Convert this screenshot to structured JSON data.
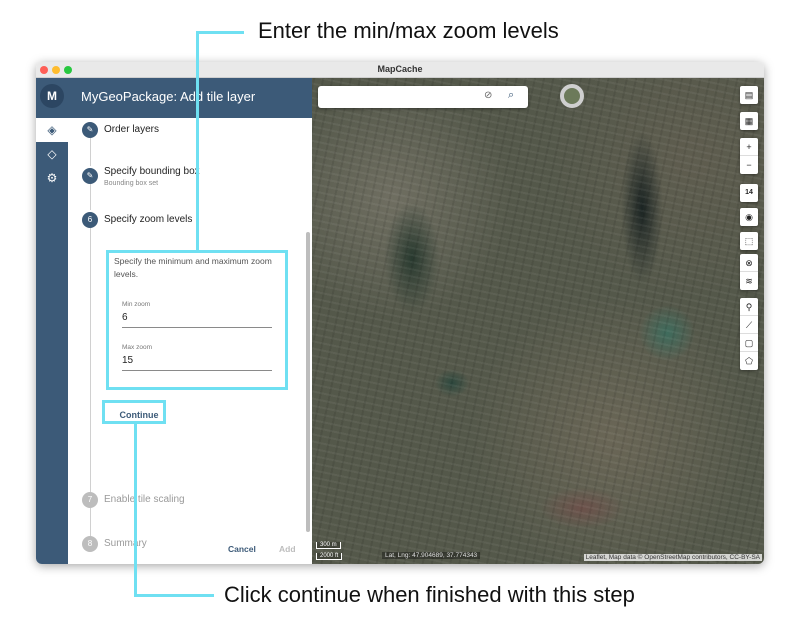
{
  "annotations": {
    "top": "Enter the min/max zoom levels",
    "bottom": "Click continue when finished with this step"
  },
  "window": {
    "title": "MapCache"
  },
  "panel": {
    "title": "MyGeoPackage: Add tile layer",
    "steps": [
      {
        "label": "Order layers",
        "state": "done"
      },
      {
        "label": "Specify bounding box",
        "sub": "Bounding box set",
        "state": "done"
      },
      {
        "number": "6",
        "label": "Specify zoom levels",
        "state": "active"
      },
      {
        "number": "7",
        "label": "Enable tile scaling",
        "state": "pending"
      },
      {
        "number": "8",
        "label": "Summary",
        "state": "pending"
      }
    ],
    "zoom_description": "Specify the minimum and maximum zoom levels.",
    "min_zoom": {
      "label": "Min zoom",
      "value": "6"
    },
    "max_zoom": {
      "label": "Max zoom",
      "value": "15"
    },
    "continue_label": "Continue",
    "cancel_label": "Cancel",
    "add_label": "Add"
  },
  "map": {
    "zoom_level": "14",
    "scale_metric": "300 m",
    "scale_imperial": "2000 ft",
    "latlng": "Lat, Lng: 47.904689, 37.774343",
    "attribution": "Leaflet, Map data © OpenStreetMap contributors, CC-BY-SA"
  },
  "colors": {
    "accent": "#3c5a78",
    "highlight": "#6fe0f2"
  }
}
